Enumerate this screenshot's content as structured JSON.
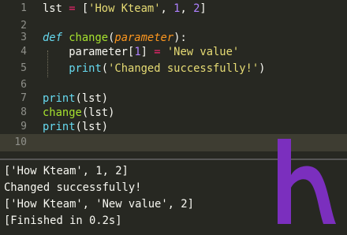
{
  "editor": {
    "line_numbers": [
      "1",
      "2",
      "3",
      "4",
      "5",
      "6",
      "7",
      "8",
      "9",
      "10"
    ],
    "line1": {
      "var": "lst",
      "eq": " = ",
      "lb": "[",
      "s1": "'How Kteam'",
      "c1": ", ",
      "n1": "1",
      "c2": ", ",
      "n2": "2",
      "rb": "]"
    },
    "line3": {
      "def": "def",
      "sp": " ",
      "name": "change",
      "lp": "(",
      "param": "parameter",
      "rp": "):"
    },
    "line4": {
      "indent": "    ",
      "var": "parameter",
      "lb": "[",
      "idx": "1",
      "rb": "]",
      "eq": " = ",
      "val": "'New value'"
    },
    "line5": {
      "indent": "    ",
      "fn": "print",
      "lp": "(",
      "str": "'Changed successfully!'",
      "rp": ")"
    },
    "line7": {
      "fn": "print",
      "args": "(lst)"
    },
    "line8": {
      "fn": "change",
      "args": "(lst)"
    },
    "line9": {
      "fn": "print",
      "args": "(lst)"
    }
  },
  "output": {
    "lines": [
      "['How Kteam', 1, 2]",
      "Changed successfully!",
      "['How Kteam', 'New value', 2]",
      "[Finished in 0.2s]"
    ]
  },
  "colors": {
    "background": "#272822",
    "keyword": "#66d9ef",
    "function": "#a6e22e",
    "string": "#e6db74",
    "number": "#ae81ff",
    "operator": "#f92672",
    "parameter": "#fd971f",
    "logo": "#7b2fbe"
  },
  "icons": {
    "logo": "kteam-logo"
  }
}
